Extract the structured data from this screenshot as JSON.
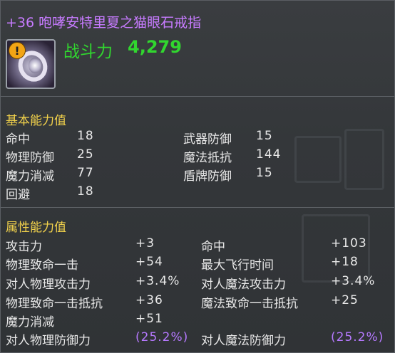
{
  "item": {
    "name": "+36 咆哮安特里夏之猫眼石戒指",
    "power_label": "战斗力",
    "power_value": "4,279",
    "warning_glyph": "!",
    "name_color": "#c77bff",
    "power_color": "#31d62f"
  },
  "basic": {
    "title": "基本能力值",
    "left": [
      {
        "label": "命中",
        "value": "18"
      },
      {
        "label": "物理防御",
        "value": "25"
      },
      {
        "label": "魔力消减",
        "value": "77"
      },
      {
        "label": "回避",
        "value": "18"
      }
    ],
    "right": [
      {
        "label": "武器防御",
        "value": "15"
      },
      {
        "label": "魔法抵抗",
        "value": "144"
      },
      {
        "label": "盾牌防御",
        "value": "15"
      }
    ]
  },
  "attributes": {
    "title": "属性能力值",
    "left": [
      {
        "label": "攻击力",
        "value": "+3"
      },
      {
        "label": "物理致命一击",
        "value": "+54"
      },
      {
        "label": "对人物理攻击力",
        "value": "+3.4%"
      },
      {
        "label": "物理致命一击抵抗",
        "value": "+36"
      },
      {
        "label": "魔力消减",
        "value": "+51"
      },
      {
        "label": "对人物理防御力",
        "value": "(25.2%)"
      }
    ],
    "right": [
      {
        "label": "命中",
        "value": "+103"
      },
      {
        "label": "最大飞行时间",
        "value": "+18"
      },
      {
        "label": "对人魔法攻击力",
        "value": "+3.4%"
      },
      {
        "label": "魔法致命一击抵抗",
        "value": "+25"
      },
      {
        "label": "对人魔法防御力",
        "value": "(25.2%)"
      }
    ]
  },
  "colors": {
    "section_title": "#f2d24b",
    "highlight_value": "#b679ff"
  }
}
